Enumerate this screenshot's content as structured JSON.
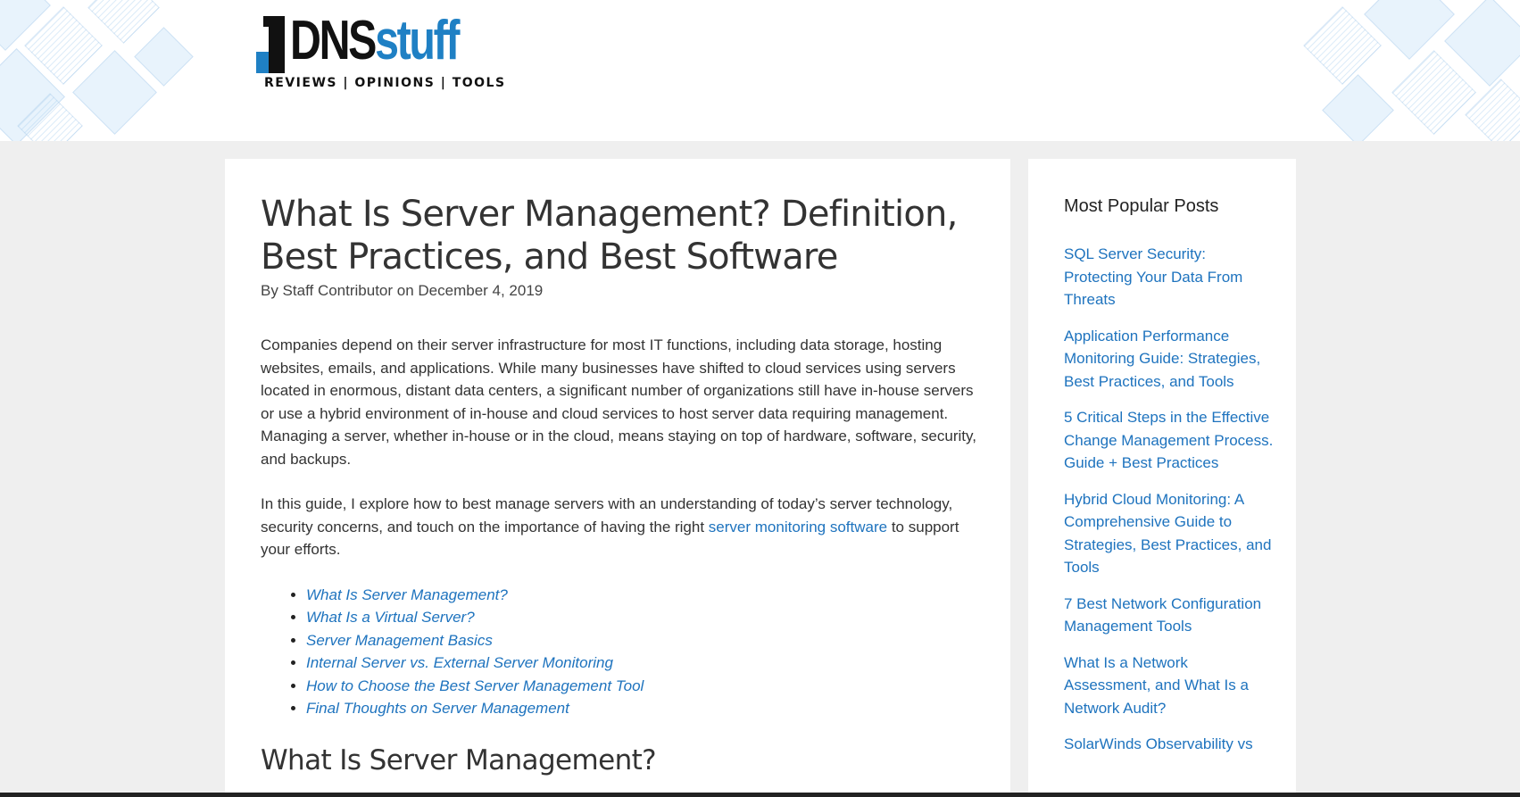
{
  "site": {
    "logo_dns": "DNS",
    "logo_stuff": "stuff",
    "tagline": "REVIEWS | OPINIONS | TOOLS",
    "brand_color": "#1f80c4"
  },
  "article": {
    "title": "What Is Server Management? Definition, Best Practices, and Best Software",
    "byline": "By Staff Contributor on December 4, 2019",
    "paragraph1": "Companies depend on their server infrastructure for most IT functions, including data storage, hosting websites, emails, and applications. While many businesses have shifted to cloud services using servers located in enormous, distant data centers, a significant number of organizations still have in-house servers or use a hybrid environment of in-house and cloud services to host server data requiring management. Managing a server, whether in-house or in the cloud, means staying on top of hardware, software, security, and backups.",
    "paragraph2_before": "In this guide, I explore how to best manage servers with an understanding of today’s server technology, security concerns, and touch on the importance of having the right ",
    "paragraph2_link": "server monitoring software",
    "paragraph2_after": " to support your efforts.",
    "toc": [
      "What Is Server Management?",
      "What Is a Virtual Server?",
      "Server Management Basics",
      "Internal Server vs. External Server Monitoring",
      "How to Choose the Best Server Management Tool",
      "Final Thoughts on Server Management"
    ],
    "section_heading": "What Is Server Management?",
    "link_color": "#1e73be"
  },
  "sidebar": {
    "title": "Most Popular Posts",
    "posts": [
      "SQL Server Security: Protecting Your Data From Threats",
      "Application Performance Monitoring Guide: Strategies, Best Practices, and Tools",
      "5 Critical Steps in the Effective Change Management Process. Guide + Best Practices",
      "Hybrid Cloud Monitoring: A Comprehensive Guide to Strategies, Best Practices, and Tools",
      "7 Best Network Configuration Management Tools",
      "What Is a Network Assessment, and What Is a Network Audit?",
      "SolarWinds Observability vs"
    ]
  }
}
